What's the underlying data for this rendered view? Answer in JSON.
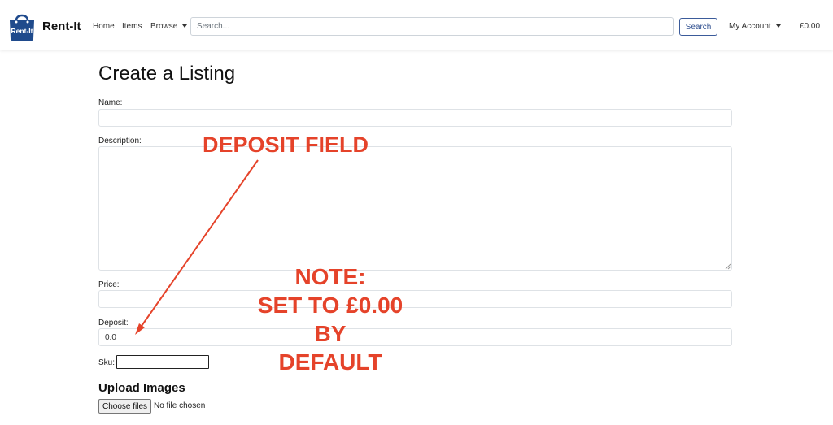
{
  "navbar": {
    "brand": {
      "logo_text": "Rent-It",
      "title": "Rent-It"
    },
    "links": {
      "home": "Home",
      "items": "Items",
      "browse": "Browse"
    },
    "search": {
      "placeholder": "Search...",
      "button": "Search"
    },
    "account": "My Account",
    "cart_total": "£0.00"
  },
  "form": {
    "title": "Create a Listing",
    "name_label": "Name:",
    "description_label": "Description:",
    "price_label": "Price:",
    "deposit_label": "Deposit:",
    "deposit_value": "0.0",
    "sku_label": "Sku:",
    "upload_heading": "Upload Images",
    "choose_files_button": "Choose files",
    "file_status": "No file chosen"
  },
  "annotations": {
    "deposit_callout": "DEPOSIT FIELD",
    "note_lines": [
      "NOTE:",
      "SET TO £0.00",
      "BY",
      "DEFAULT"
    ],
    "color": "#e5432a"
  },
  "colors": {
    "brand_blue": "#1f4a8c",
    "search_button": "#2f4f8f"
  }
}
